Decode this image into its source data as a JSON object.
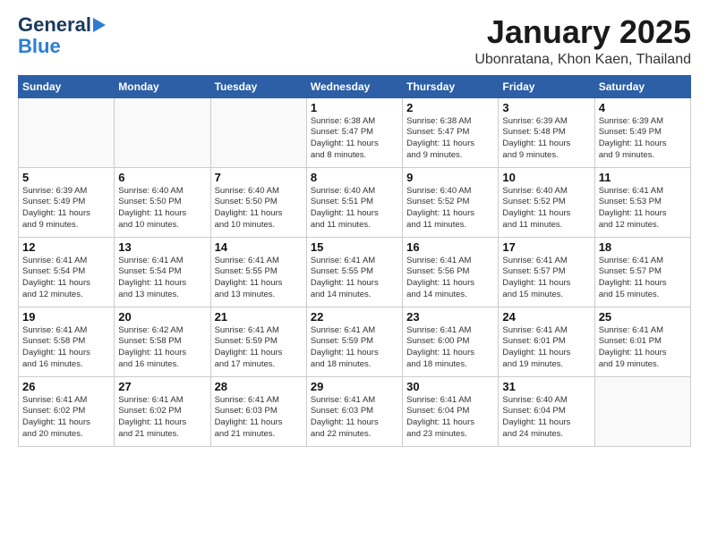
{
  "header": {
    "logo_general": "General",
    "logo_blue": "Blue",
    "month": "January 2025",
    "location": "Ubonratana, Khon Kaen, Thailand"
  },
  "weekdays": [
    "Sunday",
    "Monday",
    "Tuesday",
    "Wednesday",
    "Thursday",
    "Friday",
    "Saturday"
  ],
  "weeks": [
    [
      {
        "day": "",
        "detail": ""
      },
      {
        "day": "",
        "detail": ""
      },
      {
        "day": "",
        "detail": ""
      },
      {
        "day": "1",
        "detail": "Sunrise: 6:38 AM\nSunset: 5:47 PM\nDaylight: 11 hours\nand 8 minutes."
      },
      {
        "day": "2",
        "detail": "Sunrise: 6:38 AM\nSunset: 5:47 PM\nDaylight: 11 hours\nand 9 minutes."
      },
      {
        "day": "3",
        "detail": "Sunrise: 6:39 AM\nSunset: 5:48 PM\nDaylight: 11 hours\nand 9 minutes."
      },
      {
        "day": "4",
        "detail": "Sunrise: 6:39 AM\nSunset: 5:49 PM\nDaylight: 11 hours\nand 9 minutes."
      }
    ],
    [
      {
        "day": "5",
        "detail": "Sunrise: 6:39 AM\nSunset: 5:49 PM\nDaylight: 11 hours\nand 9 minutes."
      },
      {
        "day": "6",
        "detail": "Sunrise: 6:40 AM\nSunset: 5:50 PM\nDaylight: 11 hours\nand 10 minutes."
      },
      {
        "day": "7",
        "detail": "Sunrise: 6:40 AM\nSunset: 5:50 PM\nDaylight: 11 hours\nand 10 minutes."
      },
      {
        "day": "8",
        "detail": "Sunrise: 6:40 AM\nSunset: 5:51 PM\nDaylight: 11 hours\nand 11 minutes."
      },
      {
        "day": "9",
        "detail": "Sunrise: 6:40 AM\nSunset: 5:52 PM\nDaylight: 11 hours\nand 11 minutes."
      },
      {
        "day": "10",
        "detail": "Sunrise: 6:40 AM\nSunset: 5:52 PM\nDaylight: 11 hours\nand 11 minutes."
      },
      {
        "day": "11",
        "detail": "Sunrise: 6:41 AM\nSunset: 5:53 PM\nDaylight: 11 hours\nand 12 minutes."
      }
    ],
    [
      {
        "day": "12",
        "detail": "Sunrise: 6:41 AM\nSunset: 5:54 PM\nDaylight: 11 hours\nand 12 minutes."
      },
      {
        "day": "13",
        "detail": "Sunrise: 6:41 AM\nSunset: 5:54 PM\nDaylight: 11 hours\nand 13 minutes."
      },
      {
        "day": "14",
        "detail": "Sunrise: 6:41 AM\nSunset: 5:55 PM\nDaylight: 11 hours\nand 13 minutes."
      },
      {
        "day": "15",
        "detail": "Sunrise: 6:41 AM\nSunset: 5:55 PM\nDaylight: 11 hours\nand 14 minutes."
      },
      {
        "day": "16",
        "detail": "Sunrise: 6:41 AM\nSunset: 5:56 PM\nDaylight: 11 hours\nand 14 minutes."
      },
      {
        "day": "17",
        "detail": "Sunrise: 6:41 AM\nSunset: 5:57 PM\nDaylight: 11 hours\nand 15 minutes."
      },
      {
        "day": "18",
        "detail": "Sunrise: 6:41 AM\nSunset: 5:57 PM\nDaylight: 11 hours\nand 15 minutes."
      }
    ],
    [
      {
        "day": "19",
        "detail": "Sunrise: 6:41 AM\nSunset: 5:58 PM\nDaylight: 11 hours\nand 16 minutes."
      },
      {
        "day": "20",
        "detail": "Sunrise: 6:42 AM\nSunset: 5:58 PM\nDaylight: 11 hours\nand 16 minutes."
      },
      {
        "day": "21",
        "detail": "Sunrise: 6:41 AM\nSunset: 5:59 PM\nDaylight: 11 hours\nand 17 minutes."
      },
      {
        "day": "22",
        "detail": "Sunrise: 6:41 AM\nSunset: 5:59 PM\nDaylight: 11 hours\nand 18 minutes."
      },
      {
        "day": "23",
        "detail": "Sunrise: 6:41 AM\nSunset: 6:00 PM\nDaylight: 11 hours\nand 18 minutes."
      },
      {
        "day": "24",
        "detail": "Sunrise: 6:41 AM\nSunset: 6:01 PM\nDaylight: 11 hours\nand 19 minutes."
      },
      {
        "day": "25",
        "detail": "Sunrise: 6:41 AM\nSunset: 6:01 PM\nDaylight: 11 hours\nand 19 minutes."
      }
    ],
    [
      {
        "day": "26",
        "detail": "Sunrise: 6:41 AM\nSunset: 6:02 PM\nDaylight: 11 hours\nand 20 minutes."
      },
      {
        "day": "27",
        "detail": "Sunrise: 6:41 AM\nSunset: 6:02 PM\nDaylight: 11 hours\nand 21 minutes."
      },
      {
        "day": "28",
        "detail": "Sunrise: 6:41 AM\nSunset: 6:03 PM\nDaylight: 11 hours\nand 21 minutes."
      },
      {
        "day": "29",
        "detail": "Sunrise: 6:41 AM\nSunset: 6:03 PM\nDaylight: 11 hours\nand 22 minutes."
      },
      {
        "day": "30",
        "detail": "Sunrise: 6:41 AM\nSunset: 6:04 PM\nDaylight: 11 hours\nand 23 minutes."
      },
      {
        "day": "31",
        "detail": "Sunrise: 6:40 AM\nSunset: 6:04 PM\nDaylight: 11 hours\nand 24 minutes."
      },
      {
        "day": "",
        "detail": ""
      }
    ]
  ]
}
